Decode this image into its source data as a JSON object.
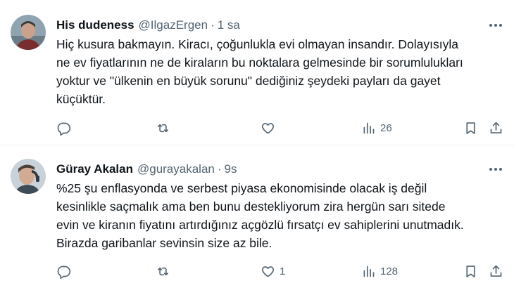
{
  "tweets": [
    {
      "name": "His dudeness",
      "handle": "@IlgazErgen",
      "separator": "·",
      "time": "1 sa",
      "lines": [
        "Hiç kusura bakmayın. Kiracı, çoğunlukla evi olmayan insandır. Dolayısıyla",
        "ne ev fiyatlarının ne de kiraların bu noktalara gelmesinde bir sorumlulukları",
        "yoktur ve \"ülkenin en büyük sorunu\" dediğiniz şeydeki payları da gayet",
        "küçüktür."
      ],
      "reply_count": "",
      "retweet_count": "",
      "like_count": "",
      "view_count": "26"
    },
    {
      "name": "Güray Akalan",
      "handle": "@gurayakalan",
      "separator": "·",
      "time": "9s",
      "lines": [
        "%25 şu enflasyonda ve serbest piyasa ekonomisinde olacak iş değil",
        "kesinlikle saçmalık ama ben bunu destekliyorum zira  hergün sarı sitede",
        "evin ve kiranın fiyatını artırdığınız açgözlü fırsatçı ev sahiplerini unutmadık.",
        "Birazda garibanlar sevinsin size az bile."
      ],
      "reply_count": "",
      "retweet_count": "",
      "like_count": "1",
      "view_count": "128"
    }
  ],
  "icons": {
    "more": "more-horizontal-icon",
    "reply": "reply-icon",
    "retweet": "retweet-icon",
    "like": "heart-icon",
    "views": "views-chart-icon",
    "bookmark": "bookmark-icon",
    "share": "share-icon"
  },
  "colors": {
    "text": "#0f1419",
    "secondary": "#536471",
    "divider": "#eff3f4"
  }
}
